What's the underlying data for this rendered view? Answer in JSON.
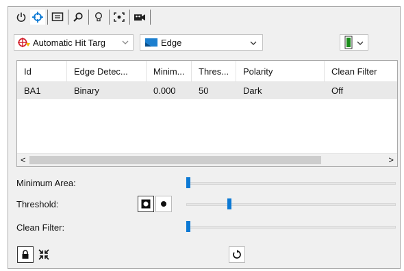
{
  "toolbar": {
    "buttons": [
      {
        "icon": "power-icon"
      },
      {
        "icon": "crosshair-icon",
        "selected": true
      },
      {
        "icon": "image-frame-icon"
      },
      {
        "icon": "zoom-icon"
      },
      {
        "icon": "lightbulb-icon"
      },
      {
        "icon": "focus-target-icon"
      },
      {
        "icon": "camera-record-icon"
      }
    ]
  },
  "target_combo": {
    "value": "Automatic Hit Targ",
    "icon": "target-hit-icon"
  },
  "tool_combo": {
    "value": "Edge",
    "icon": "edge-tool-icon"
  },
  "color_combo": {
    "icon": "color-swatch-icon",
    "color": "#1a8c1a"
  },
  "table": {
    "columns": [
      "Id",
      "Edge Detec...",
      "Minim...",
      "Thres...",
      "Polarity",
      "Clean Filter"
    ],
    "rows": [
      [
        "BA1",
        "Binary",
        "0.000",
        "50",
        "Dark",
        "Off"
      ]
    ]
  },
  "scroll": {
    "left": "<",
    "right": ">"
  },
  "controls": {
    "minimum_area": {
      "label": "Minimum Area:",
      "value_fraction": 0.0
    },
    "threshold": {
      "label": "Threshold:",
      "value_fraction": 0.2
    },
    "clean_filter": {
      "label": "Clean Filter:",
      "value_fraction": 0.0
    }
  },
  "accent_color": "#0c79d4"
}
